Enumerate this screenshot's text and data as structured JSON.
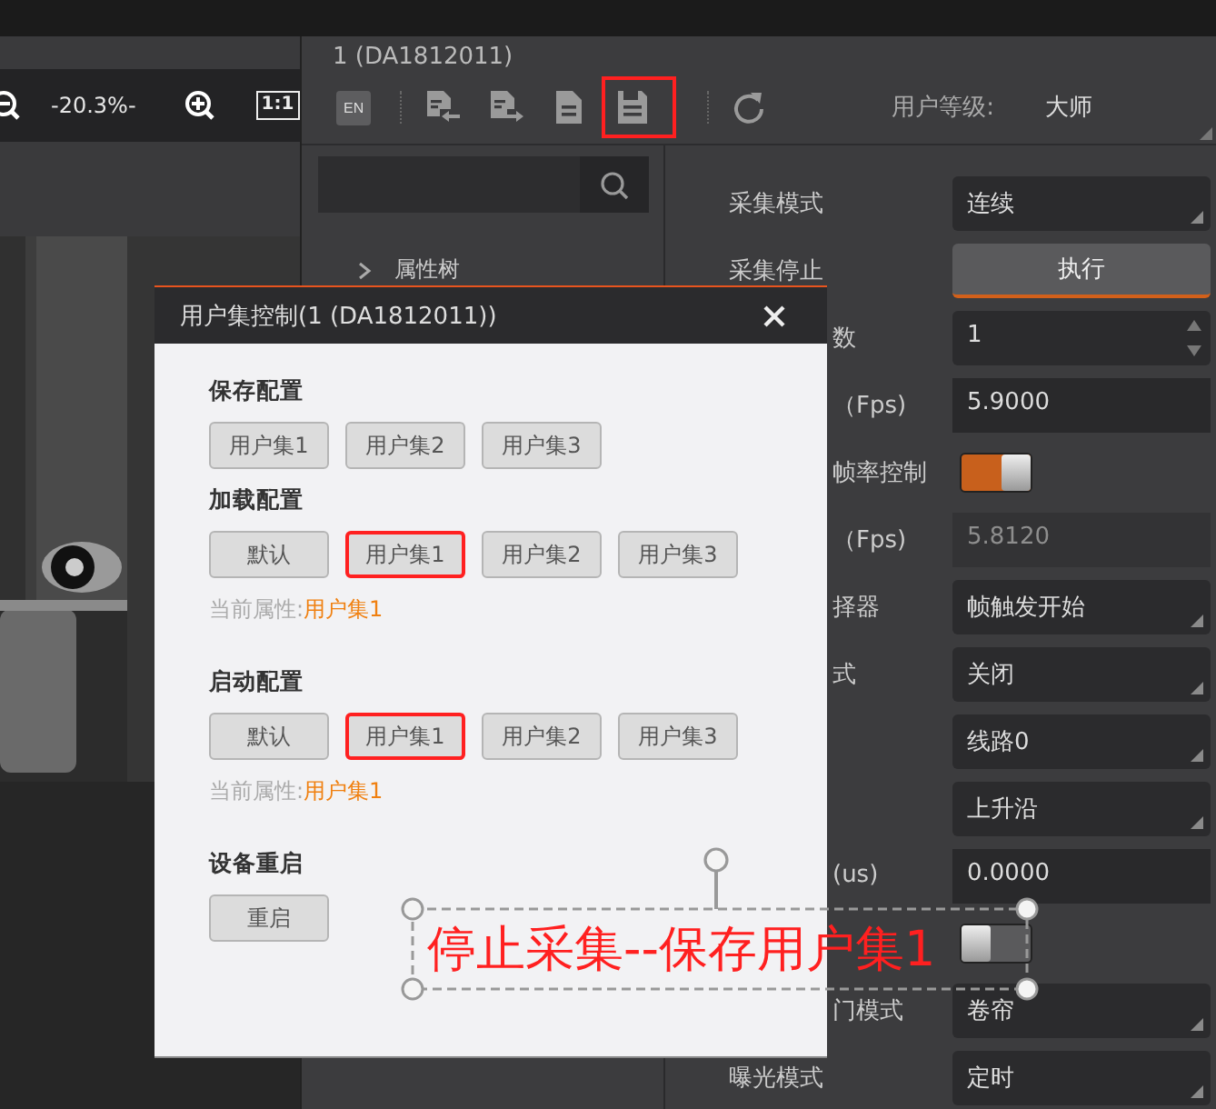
{
  "viewer": {
    "zoom": "-20.3%-",
    "actual_size": "1:1"
  },
  "device": {
    "title": "1 (DA1812011)",
    "user_level_label": "用户等级:",
    "user_level": "大师",
    "toolbar": [
      {
        "kind": "language",
        "label": "EN",
        "highlighted": false
      },
      {
        "kind": "separator"
      },
      {
        "kind": "import",
        "highlighted": false
      },
      {
        "kind": "export",
        "highlighted": false
      },
      {
        "kind": "document",
        "highlighted": false
      },
      {
        "kind": "save",
        "highlighted": true
      },
      {
        "kind": "separator"
      },
      {
        "kind": "refresh",
        "highlighted": false
      }
    ]
  },
  "tree": {
    "items": [
      {
        "label": "属性树",
        "expanded": false
      }
    ]
  },
  "properties": [
    {
      "label": "采集模式",
      "clipped": false,
      "kind": "select",
      "value": "连续"
    },
    {
      "label": "采集停止",
      "clipped": false,
      "kind": "button",
      "value": "执行"
    },
    {
      "label": "数",
      "clipped": true,
      "kind": "spin",
      "value": "1"
    },
    {
      "label": "（Fps)",
      "clipped": true,
      "kind": "input",
      "value": "5.9000"
    },
    {
      "label": "帧率控制",
      "clipped": true,
      "kind": "switch",
      "on": true
    },
    {
      "label": "（Fps)",
      "clipped": true,
      "kind": "readonly",
      "reading": "5.8120"
    },
    {
      "label": "择器",
      "clipped": true,
      "kind": "select",
      "value": "帧触发开始"
    },
    {
      "label": "式",
      "clipped": true,
      "kind": "select",
      "value": "关闭"
    },
    {
      "kind": "select",
      "value": "线路0"
    },
    {
      "kind": "select",
      "value": "上升沿"
    },
    {
      "label": "(us)",
      "clipped": true,
      "kind": "input",
      "value": "0.0000"
    },
    {
      "kind": "switch",
      "on": false
    },
    {
      "label": "门模式",
      "clipped": true,
      "kind": "select",
      "value": "卷帘"
    },
    {
      "label": "曝光模式",
      "clipped": false,
      "kind": "select",
      "value": "定时"
    }
  ],
  "dialog": {
    "title": "用户集控制(1 (DA1812011))",
    "sections": [
      {
        "heading": "保存配置",
        "buttons": [
          {
            "label": "用户集1",
            "highlighted": false
          },
          {
            "label": "用户集2",
            "highlighted": false
          },
          {
            "label": "用户集3",
            "highlighted": false
          }
        ]
      },
      {
        "heading": "加载配置",
        "buttons": [
          {
            "label": "默认",
            "highlighted": false
          },
          {
            "label": "用户集1",
            "highlighted": true
          },
          {
            "label": "用户集2",
            "highlighted": false
          },
          {
            "label": "用户集3",
            "highlighted": false
          }
        ],
        "current_label": "当前属性:",
        "current_value": "用户集1"
      },
      {
        "heading": "启动配置",
        "buttons": [
          {
            "label": "默认",
            "highlighted": false
          },
          {
            "label": "用户集1",
            "highlighted": true
          },
          {
            "label": "用户集2",
            "highlighted": false
          },
          {
            "label": "用户集3",
            "highlighted": false
          }
        ],
        "current_label": "当前属性:",
        "current_value": "用户集1"
      },
      {
        "heading": "设备重启",
        "buttons": [
          {
            "label": "重启",
            "highlighted": false
          }
        ]
      }
    ]
  },
  "annotation": {
    "text": "停止采集--保存用户集1"
  }
}
